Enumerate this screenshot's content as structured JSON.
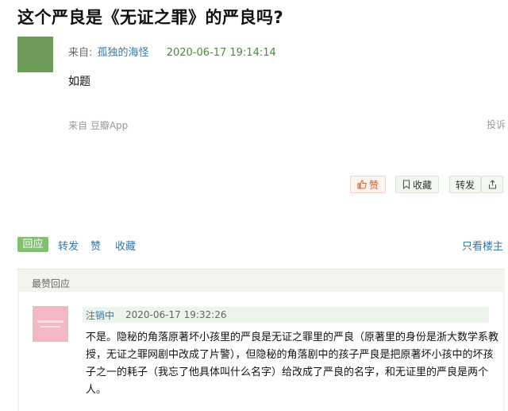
{
  "post": {
    "title": "这个严良是《无证之罪》的严良吗?",
    "from_label": "来自:",
    "author": "孤独的海怪",
    "time": "2020-06-17 19:14:14",
    "body": "如题",
    "source": "来自 豆瓣App",
    "report": "投诉"
  },
  "actions": {
    "like_label": "赞",
    "collect_label": "收藏",
    "share_label": "转发"
  },
  "tabs": {
    "reply": "回应",
    "forward": "转发",
    "like": "赞",
    "collect": "收藏",
    "only_op": "只看楼主"
  },
  "hot_replies": {
    "header": "最赞回应",
    "items": [
      {
        "author": "注销中",
        "time": "2020-06-17 19:32:26",
        "lines": [
          "不是。隐秘的角落原著坏小孩里的严良是无证之罪里的严良（原著里的身份是浙大数学系教",
          "授，无证之罪网剧中改成了片警），但隐秘的角落剧中的孩子严良是把原著坏小孩中的坏孩",
          "子之一的耗子（我忘了他具体叫什么名字）给改成了严良的名字，和无证里的严良是两个",
          "人。"
        ]
      }
    ]
  },
  "colors": {
    "link": "#3377aa",
    "time_green": "#4a8a3a",
    "tab_active_bg": "#83bf73",
    "like_orange": "#d45c2c"
  }
}
